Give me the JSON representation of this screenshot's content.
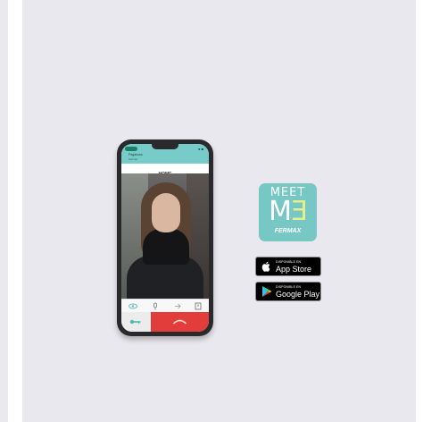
{
  "app": {
    "status_right": "● ■",
    "user_label": "Pagakusa",
    "sub_label": "Fermax",
    "home_title": "HOME",
    "controls": [
      {
        "name": "eye-icon"
      },
      {
        "name": "mic-icon"
      },
      {
        "name": "arrow-icon"
      },
      {
        "name": "box-icon"
      }
    ],
    "open_icon": "key-icon",
    "hangup_icon": "phone-hangup-icon"
  },
  "logo": {
    "meet": "MEET",
    "me_m": "M",
    "me_e": "Ǝ",
    "brand": "FERMAX"
  },
  "badges": {
    "app_store": {
      "small": "DISPONIBLE EN",
      "big": "App Store"
    },
    "google_play": {
      "small": "DISPONIBLE EN",
      "big": "Google Play"
    }
  },
  "colors": {
    "panel": "#e9e8ee",
    "teal": "#77c7c5",
    "hangup": "#e23d3b",
    "accent_yellow": "#e6ef8a"
  }
}
